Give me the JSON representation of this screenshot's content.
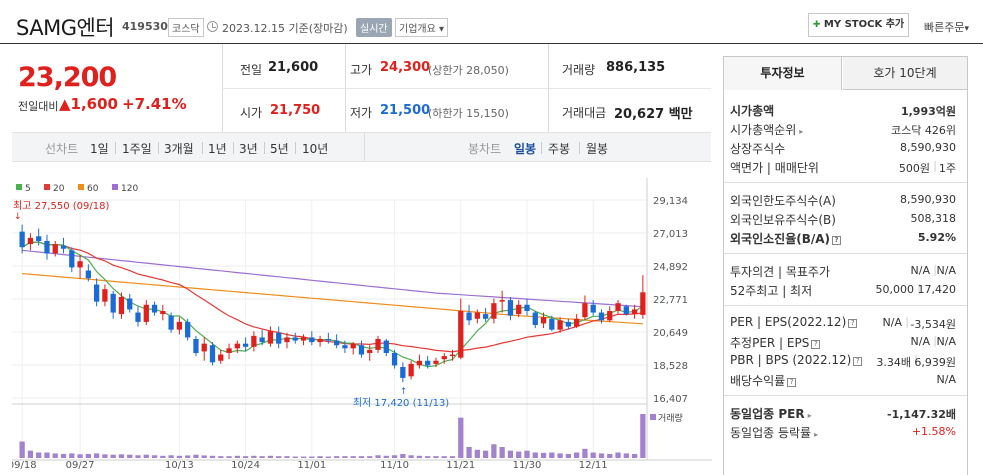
{
  "header": {
    "name": "SAMG엔터",
    "code": "419530",
    "market": "코스닥",
    "date": "2023.12.15 기준(장마감)",
    "realtime": "실시간",
    "company_info": "기업개요 ▾",
    "mystock_button": "MY STOCK 추가",
    "quick_order": "빠른주문",
    "plus_icon": "✚",
    "chevron_icon": "▾"
  },
  "price": {
    "current": "23,200",
    "prev_label": "전일대비",
    "change": "▲1,600",
    "change_pct": "+7.41%"
  },
  "stats": {
    "prev_label": "전일",
    "prev_value": "21,600",
    "open_label": "시가",
    "open_value": "21,750",
    "high_label": "고가",
    "high_value": "24,300",
    "upper_limit": "(상한가 28,050)",
    "low_label": "저가",
    "low_value": "21,500",
    "lower_limit": "(하한가 15,150)",
    "volume_label": "거래량",
    "volume_value": "886,135",
    "amount_label": "거래대금",
    "amount_value": "20,627 백만"
  },
  "periods": {
    "line_label": "선차트",
    "line_items": [
      "1일",
      "1주일",
      "3개월",
      "1년",
      "3년",
      "5년",
      "10년"
    ],
    "candle_label": "봉차트",
    "candle_items": [
      "일봉",
      "주봉",
      "월봉"
    ],
    "selected": "일봉"
  },
  "chart_data": {
    "type": "candlestick",
    "legend": [
      {
        "name": "5",
        "color": "#4caf50"
      },
      {
        "name": "20",
        "color": "#e53935"
      },
      {
        "name": "60",
        "color": "#f08c1a"
      },
      {
        "name": "120",
        "color": "#9c6fd1"
      }
    ],
    "y_ticks": [
      "29,134",
      "27,013",
      "24,892",
      "22,771",
      "20,649",
      "18,528",
      "16,407"
    ],
    "ylim": [
      16407,
      29134
    ],
    "x_labels": [
      "09/18",
      "09/27",
      "10/13",
      "10/24",
      "11/01",
      "11/10",
      "11/21",
      "11/30",
      "12/11"
    ],
    "max_label": "최고 27,550 (09/18)",
    "min_label": "최저 17,420 (11/13)",
    "volume_label": "거래량",
    "candles": [
      {
        "o": 27100,
        "h": 27550,
        "l": 25700,
        "c": 26100
      },
      {
        "o": 26300,
        "h": 27000,
        "l": 25900,
        "c": 26700
      },
      {
        "o": 26800,
        "h": 27300,
        "l": 26200,
        "c": 26500
      },
      {
        "o": 26500,
        "h": 26900,
        "l": 25300,
        "c": 25700
      },
      {
        "o": 25700,
        "h": 26500,
        "l": 25500,
        "c": 26300
      },
      {
        "o": 26200,
        "h": 26700,
        "l": 25700,
        "c": 26000
      },
      {
        "o": 25900,
        "h": 26100,
        "l": 24500,
        "c": 24800
      },
      {
        "o": 24800,
        "h": 25600,
        "l": 24100,
        "c": 25200
      },
      {
        "o": 24600,
        "h": 25000,
        "l": 23900,
        "c": 24100
      },
      {
        "o": 23700,
        "h": 24100,
        "l": 22300,
        "c": 22600
      },
      {
        "o": 22600,
        "h": 23700,
        "l": 22300,
        "c": 23400
      },
      {
        "o": 23100,
        "h": 23300,
        "l": 21500,
        "c": 21900
      },
      {
        "o": 21800,
        "h": 23200,
        "l": 21500,
        "c": 22900
      },
      {
        "o": 22800,
        "h": 23100,
        "l": 21900,
        "c": 22100
      },
      {
        "o": 21900,
        "h": 22300,
        "l": 21000,
        "c": 21300
      },
      {
        "o": 21300,
        "h": 22700,
        "l": 21100,
        "c": 22400
      },
      {
        "o": 22400,
        "h": 22600,
        "l": 21700,
        "c": 21900
      },
      {
        "o": 21800,
        "h": 22400,
        "l": 21400,
        "c": 22000
      },
      {
        "o": 21700,
        "h": 21900,
        "l": 20600,
        "c": 20800
      },
      {
        "o": 20800,
        "h": 21600,
        "l": 20500,
        "c": 21300
      },
      {
        "o": 21300,
        "h": 21500,
        "l": 20100,
        "c": 20300
      },
      {
        "o": 20200,
        "h": 20400,
        "l": 19100,
        "c": 19300
      },
      {
        "o": 19400,
        "h": 20300,
        "l": 18800,
        "c": 19900
      },
      {
        "o": 19800,
        "h": 20000,
        "l": 18500,
        "c": 18700
      },
      {
        "o": 18800,
        "h": 19500,
        "l": 18600,
        "c": 19200
      },
      {
        "o": 19300,
        "h": 19900,
        "l": 18900,
        "c": 19600
      },
      {
        "o": 19600,
        "h": 20100,
        "l": 19300,
        "c": 19900
      },
      {
        "o": 19900,
        "h": 20300,
        "l": 19400,
        "c": 19700
      },
      {
        "o": 19700,
        "h": 20700,
        "l": 19400,
        "c": 20400
      },
      {
        "o": 20300,
        "h": 20800,
        "l": 19800,
        "c": 20000
      },
      {
        "o": 19900,
        "h": 21000,
        "l": 19700,
        "c": 20700
      },
      {
        "o": 20600,
        "h": 21000,
        "l": 19600,
        "c": 19900
      },
      {
        "o": 20000,
        "h": 20600,
        "l": 19600,
        "c": 20300
      },
      {
        "o": 20300,
        "h": 20600,
        "l": 19900,
        "c": 20100
      },
      {
        "o": 20100,
        "h": 20500,
        "l": 19800,
        "c": 20300
      },
      {
        "o": 20300,
        "h": 20700,
        "l": 19800,
        "c": 20000
      },
      {
        "o": 20000,
        "h": 20400,
        "l": 19700,
        "c": 20200
      },
      {
        "o": 20200,
        "h": 20600,
        "l": 19900,
        "c": 20100
      },
      {
        "o": 20100,
        "h": 20500,
        "l": 19600,
        "c": 19800
      },
      {
        "o": 19800,
        "h": 20100,
        "l": 19300,
        "c": 19600
      },
      {
        "o": 19600,
        "h": 20000,
        "l": 19200,
        "c": 19900
      },
      {
        "o": 19800,
        "h": 20100,
        "l": 19000,
        "c": 19200
      },
      {
        "o": 19300,
        "h": 19800,
        "l": 18800,
        "c": 19500
      },
      {
        "o": 19500,
        "h": 20400,
        "l": 19300,
        "c": 20200
      },
      {
        "o": 20100,
        "h": 20200,
        "l": 19100,
        "c": 19300
      },
      {
        "o": 19300,
        "h": 19500,
        "l": 18300,
        "c": 18500
      },
      {
        "o": 18400,
        "h": 18700,
        "l": 17420,
        "c": 17700
      },
      {
        "o": 17800,
        "h": 18800,
        "l": 17600,
        "c": 18600
      },
      {
        "o": 18500,
        "h": 19200,
        "l": 18300,
        "c": 18800
      },
      {
        "o": 18800,
        "h": 19100,
        "l": 18300,
        "c": 18500
      },
      {
        "o": 18600,
        "h": 19000,
        "l": 18400,
        "c": 18800
      },
      {
        "o": 18900,
        "h": 19300,
        "l": 18600,
        "c": 19100
      },
      {
        "o": 19100,
        "h": 19500,
        "l": 18800,
        "c": 19200
      },
      {
        "o": 19000,
        "h": 22800,
        "l": 18900,
        "c": 22000
      },
      {
        "o": 21900,
        "h": 22400,
        "l": 21100,
        "c": 21400
      },
      {
        "o": 21500,
        "h": 22100,
        "l": 21200,
        "c": 21900
      },
      {
        "o": 21800,
        "h": 22200,
        "l": 21300,
        "c": 21500
      },
      {
        "o": 21500,
        "h": 22800,
        "l": 21200,
        "c": 22500
      },
      {
        "o": 22600,
        "h": 23300,
        "l": 21900,
        "c": 22700
      },
      {
        "o": 22700,
        "h": 22900,
        "l": 21400,
        "c": 21700
      },
      {
        "o": 21800,
        "h": 22700,
        "l": 21600,
        "c": 22400
      },
      {
        "o": 22400,
        "h": 22800,
        "l": 21700,
        "c": 22000
      },
      {
        "o": 21900,
        "h": 22000,
        "l": 20900,
        "c": 21100
      },
      {
        "o": 21200,
        "h": 21900,
        "l": 20900,
        "c": 21600
      },
      {
        "o": 21500,
        "h": 21700,
        "l": 20700,
        "c": 20800
      },
      {
        "o": 20800,
        "h": 21600,
        "l": 20600,
        "c": 21400
      },
      {
        "o": 21300,
        "h": 21500,
        "l": 20800,
        "c": 21000
      },
      {
        "o": 21000,
        "h": 21800,
        "l": 20900,
        "c": 21500
      },
      {
        "o": 21600,
        "h": 23000,
        "l": 21400,
        "c": 22500
      },
      {
        "o": 22400,
        "h": 22700,
        "l": 21700,
        "c": 21900
      },
      {
        "o": 21900,
        "h": 22100,
        "l": 21200,
        "c": 21400
      },
      {
        "o": 21400,
        "h": 22300,
        "l": 21300,
        "c": 22000
      },
      {
        "o": 22000,
        "h": 22700,
        "l": 21800,
        "c": 22500
      },
      {
        "o": 22300,
        "h": 22400,
        "l": 21700,
        "c": 21800
      },
      {
        "o": 21800,
        "h": 22400,
        "l": 21500,
        "c": 22100
      },
      {
        "o": 21750,
        "h": 24300,
        "l": 21500,
        "c": 23200
      }
    ],
    "volumes": [
      90,
      40,
      30,
      30,
      25,
      22,
      25,
      20,
      22,
      25,
      20,
      18,
      20,
      18,
      15,
      18,
      15,
      12,
      15,
      12,
      14,
      18,
      14,
      12,
      10,
      10,
      12,
      10,
      12,
      10,
      12,
      10,
      10,
      8,
      8,
      8,
      10,
      8,
      10,
      10,
      10,
      10,
      10,
      15,
      12,
      15,
      22,
      15,
      12,
      10,
      10,
      10,
      10,
      220,
      60,
      45,
      40,
      75,
      60,
      40,
      35,
      40,
      30,
      28,
      30,
      25,
      22,
      30,
      50,
      30,
      25,
      22,
      30,
      25,
      22,
      240
    ]
  },
  "invest_panel": {
    "tab_info": "투자정보",
    "tab_orderbook": "호가 10단계",
    "market_cap_label": "시가총액",
    "market_cap_value": "1,993억원",
    "market_cap_rank_label": "시가총액순위",
    "market_cap_rank_value": "코스닥 426위",
    "shares_label": "상장주식수",
    "shares_value": "8,590,930",
    "par_label": "액면가 | 매매단위",
    "par_value": "500원",
    "unit_value": "1주",
    "foreign_limit_label": "외국인한도주식수(A)",
    "foreign_limit_value": "8,590,930",
    "foreign_hold_label": "외국인보유주식수(B)",
    "foreign_hold_value": "508,318",
    "foreign_ratio_label": "외국인소진율(B/A)",
    "foreign_ratio_value": "5.92%",
    "opinion_label": "투자의견 | 목표주가",
    "opinion_value": "N/A",
    "target_value": "N/A",
    "week52_label": "52주최고 | 최저",
    "week52_high": "50,000",
    "week52_low": "17,420",
    "per_label": "PER | EPS(2022.12)",
    "per_value": "N/A",
    "eps_value": "-3,534원",
    "est_per_label": "추정PER | EPS",
    "est_per_value": "N/A",
    "est_eps_value": "N/A",
    "pbr_label": "PBR | BPS (2022.12)",
    "pbr_value": "3.34배",
    "bps_value": "6,939원",
    "dividend_label": "배당수익률",
    "dividend_value": "N/A",
    "sector_per_label": "동일업종 PER",
    "sector_per_value": "-1,147.32배",
    "sector_change_label": "동일업종 등락률",
    "sector_change_value": "+1.58%",
    "help_icon": "?"
  }
}
